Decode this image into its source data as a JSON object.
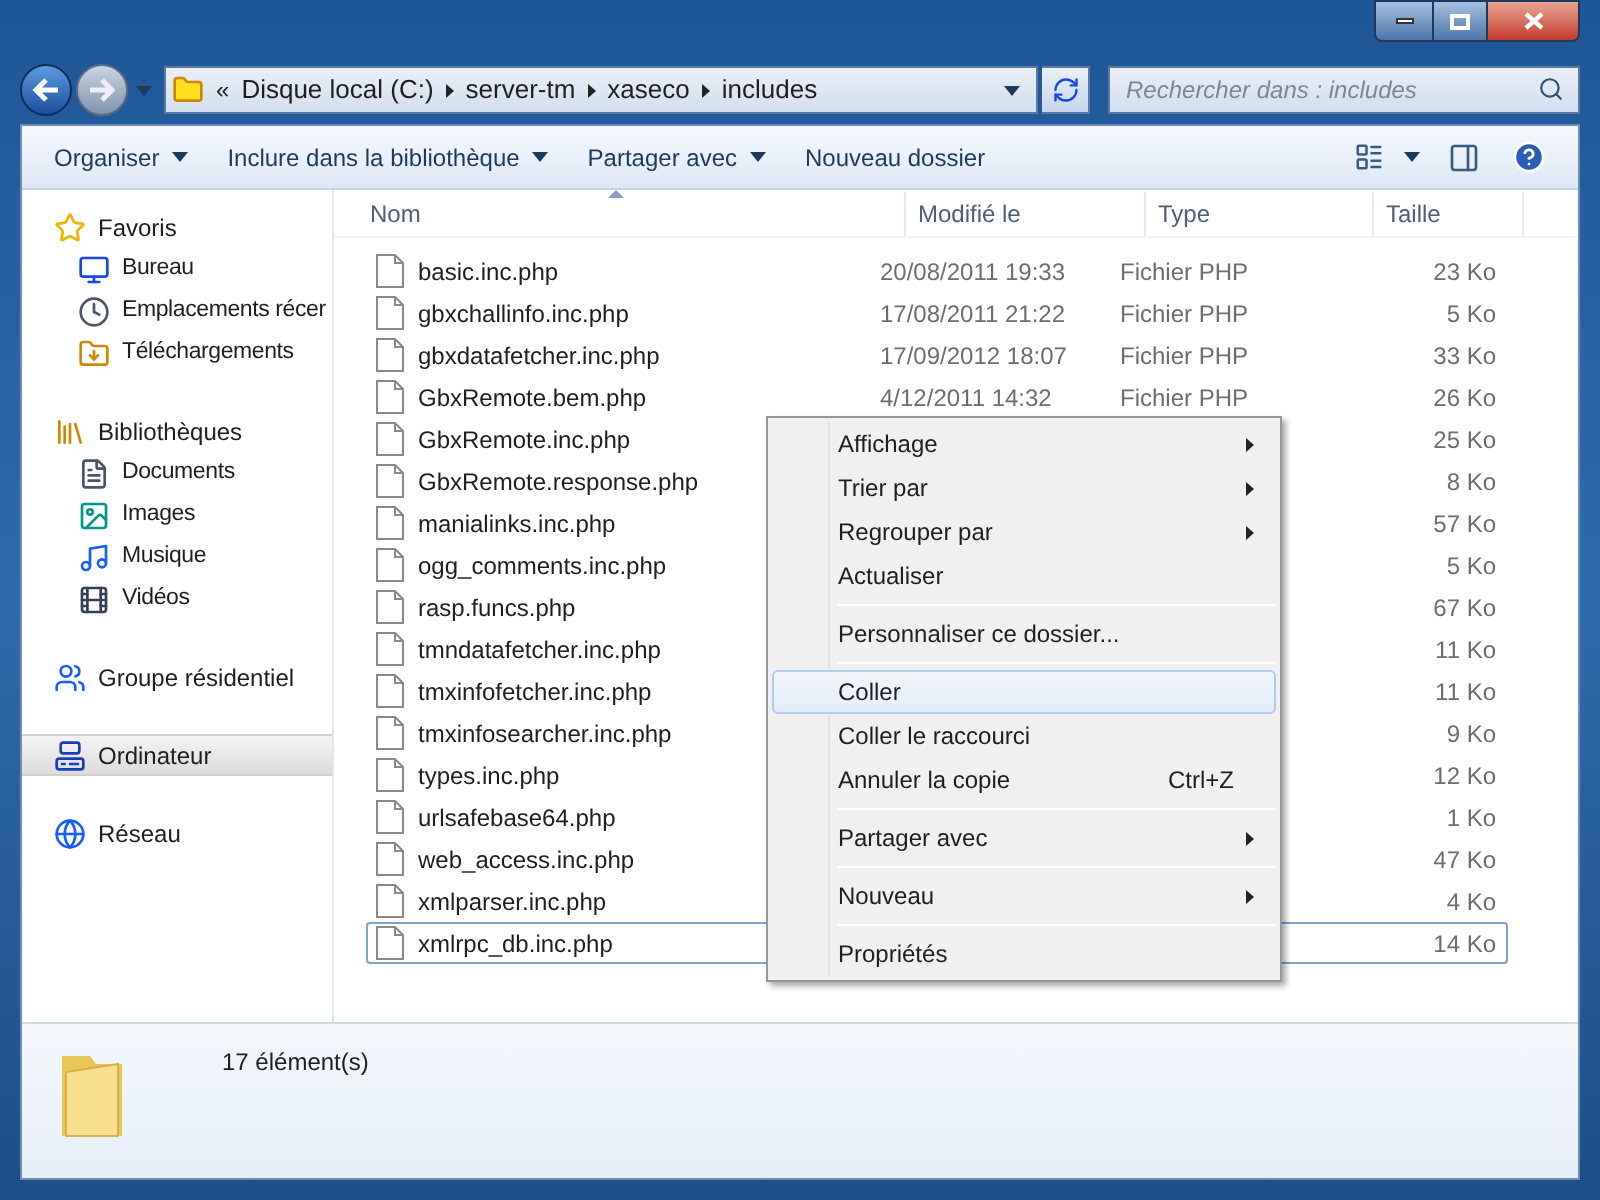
{
  "address_bar": {
    "overflow": "«",
    "crumbs": [
      "Disque local (C:)",
      "server-tm",
      "xaseco",
      "includes"
    ]
  },
  "search": {
    "placeholder": "Rechercher dans : includes"
  },
  "toolbar": [
    {
      "label": "Organiser",
      "dropdown": true
    },
    {
      "label": "Inclure dans la bibliothèque",
      "dropdown": true
    },
    {
      "label": "Partager avec",
      "dropdown": true
    },
    {
      "label": "Nouveau dossier",
      "dropdown": false
    }
  ],
  "sidebar": [
    {
      "label": "Favoris",
      "selected": false,
      "children": [
        {
          "label": "Bureau",
          "selected": false
        },
        {
          "label": "Emplacements récer",
          "selected": false
        },
        {
          "label": "Téléchargements",
          "selected": false
        }
      ]
    },
    {
      "label": "Bibliothèques",
      "selected": false,
      "children": [
        {
          "label": "Documents",
          "selected": false
        },
        {
          "label": "Images",
          "selected": false
        },
        {
          "label": "Musique",
          "selected": false
        },
        {
          "label": "Vidéos",
          "selected": false
        }
      ]
    },
    {
      "label": "Groupe résidentiel",
      "selected": false
    },
    {
      "label": "Ordinateur",
      "selected": true
    },
    {
      "label": "Réseau",
      "selected": false
    }
  ],
  "table": {
    "columns": [
      "Nom",
      "Modifié le",
      "Type",
      "Taille"
    ],
    "rows": [
      {
        "name": "basic.inc.php",
        "modified": "20/08/2011 19:33",
        "type": "Fichier PHP",
        "size": "23 Ko",
        "focused": false
      },
      {
        "name": "gbxchallinfo.inc.php",
        "modified": "17/08/2011 21:22",
        "type": "Fichier PHP",
        "size": "5 Ko",
        "focused": false
      },
      {
        "name": "gbxdatafetcher.inc.php",
        "modified": "17/09/2012 18:07",
        "type": "Fichier PHP",
        "size": "33 Ko",
        "focused": false
      },
      {
        "name": "GbxRemote.bem.php",
        "modified": "4/12/2011 14:32",
        "type": "Fichier PHP",
        "size": "26 Ko",
        "focused": false
      },
      {
        "name": "GbxRemote.inc.php",
        "size": "25 Ko",
        "focused": false
      },
      {
        "name": "GbxRemote.response.php",
        "size": "8 Ko",
        "focused": false
      },
      {
        "name": "manialinks.inc.php",
        "size": "57 Ko",
        "focused": false
      },
      {
        "name": "ogg_comments.inc.php",
        "size": "5 Ko",
        "focused": false
      },
      {
        "name": "rasp.funcs.php",
        "size": "67 Ko",
        "focused": false
      },
      {
        "name": "tmndatafetcher.inc.php",
        "size": "11 Ko",
        "focused": false
      },
      {
        "name": "tmxinfofetcher.inc.php",
        "size": "11 Ko",
        "focused": false
      },
      {
        "name": "tmxinfosearcher.inc.php",
        "size": "9 Ko",
        "focused": false
      },
      {
        "name": "types.inc.php",
        "size": "12 Ko",
        "focused": false
      },
      {
        "name": "urlsafebase64.php",
        "size": "1 Ko",
        "focused": false
      },
      {
        "name": "web_access.inc.php",
        "size": "47 Ko",
        "focused": false
      },
      {
        "name": "xmlparser.inc.php",
        "size": "4 Ko",
        "focused": false
      },
      {
        "name": "xmlrpc_db.inc.php",
        "size": "14 Ko",
        "focused": true
      }
    ]
  },
  "context_menu": {
    "groups": [
      [
        {
          "label": "Affichage",
          "submenu": true,
          "selected": false
        },
        {
          "label": "Trier par",
          "submenu": true,
          "selected": false
        },
        {
          "label": "Regrouper par",
          "submenu": true,
          "selected": false
        },
        {
          "label": "Actualiser",
          "submenu": false,
          "selected": false
        }
      ],
      [
        {
          "label": "Personnaliser ce dossier...",
          "submenu": false,
          "selected": false
        }
      ],
      [
        {
          "label": "Coller",
          "submenu": false,
          "selected": true
        },
        {
          "label": "Coller le raccourci",
          "submenu": false,
          "selected": false
        },
        {
          "label": "Annuler la copie",
          "shortcut": "Ctrl+Z",
          "submenu": false,
          "selected": false
        }
      ],
      [
        {
          "label": "Partager avec",
          "submenu": true,
          "selected": false
        }
      ],
      [
        {
          "label": "Nouveau",
          "submenu": true,
          "selected": false
        }
      ],
      [
        {
          "label": "Propriétés",
          "submenu": false,
          "selected": false
        }
      ]
    ]
  },
  "status_bar": {
    "count": "17 élément(s)"
  }
}
